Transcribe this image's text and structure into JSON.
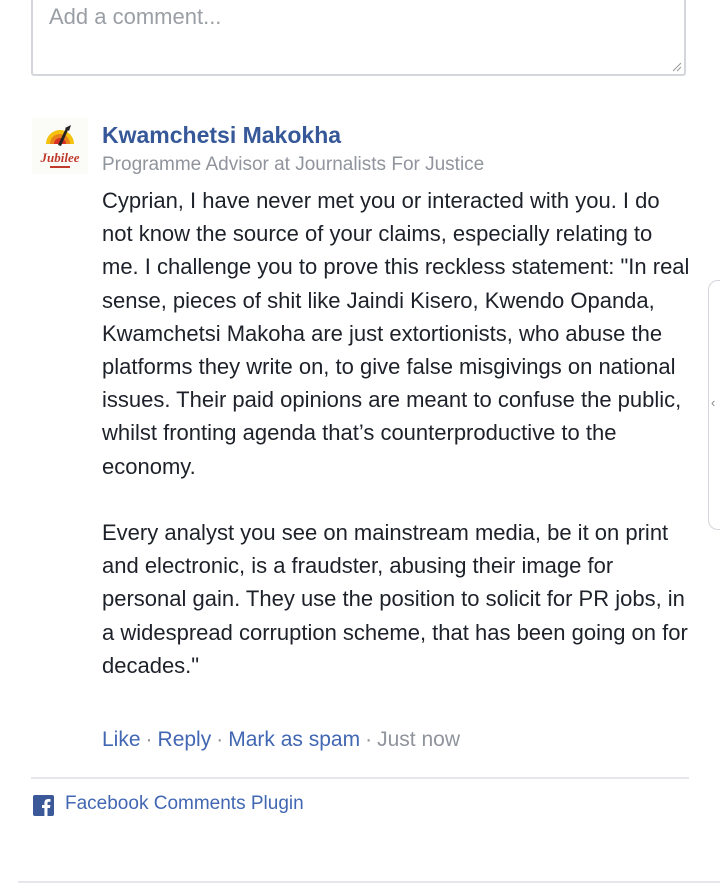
{
  "comment_input": {
    "placeholder": "Add a comment..."
  },
  "comment": {
    "avatar_label": "Jubilee",
    "author": "Kwamchetsi Makokha",
    "subtitle": "Programme Advisor at Journalists For Justice",
    "paragraphs": [
      "Cyprian, I have never met you or interacted with you. I do not know the source of your claims, especially relating to me. I challenge you to prove this reckless statement: \"In real sense, pieces of shit like Jaindi Kisero, Kwendo Opanda, Kwamchetsi Makoha are just extortionists, who abuse the platforms they write on, to give false misgivings on national issues. Their paid opinions are meant to confuse the public, whilst fronting agenda that’s counterproductive to the economy.",
      "Every analyst you see on mainstream media, be it on print and electronic, is a fraudster, abusing their image for personal gain. They use the position to solicit for PR jobs, in a widespread corruption scheme, that has been going on for decades.\""
    ],
    "actions": {
      "like": "Like",
      "reply": "Reply",
      "mark_spam": "Mark as spam",
      "timestamp": "Just now",
      "separator": "·"
    }
  },
  "footer": {
    "plugin_label": "Facebook Comments Plugin",
    "icon": "facebook-icon"
  },
  "colors": {
    "link": "#4267b2",
    "author": "#365899",
    "muted": "#90949c",
    "text": "#1d2129",
    "border": "#d3d6db"
  }
}
